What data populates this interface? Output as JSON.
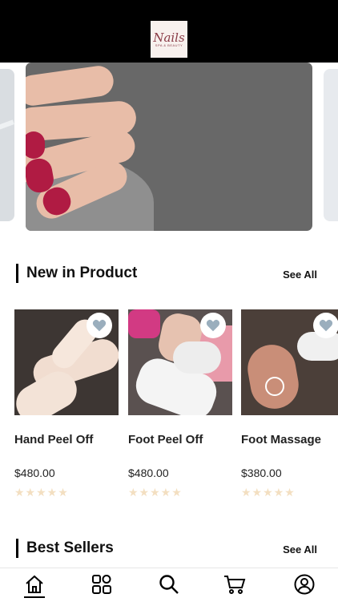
{
  "header": {
    "logo_text": "Nails",
    "logo_tagline": "SPA & BEAUTY"
  },
  "sections": {
    "new_in_product": {
      "title": "New in Product",
      "see_all": "See All"
    },
    "best_sellers": {
      "title": "Best Sellers",
      "see_all": "See All"
    }
  },
  "products": [
    {
      "name": "Hand Peel Off",
      "price": "$480.00",
      "rating": 0,
      "stars": "★★★★★"
    },
    {
      "name": "Foot Peel Off",
      "price": "$480.00",
      "rating": 0,
      "stars": "★★★★★"
    },
    {
      "name": "Foot Massage",
      "price": "$380.00",
      "rating": 0,
      "stars": "★★★★★"
    }
  ],
  "tabbar": {
    "items": [
      {
        "icon": "home-icon",
        "active": true
      },
      {
        "icon": "grid-icon",
        "active": false
      },
      {
        "icon": "search-icon",
        "active": false
      },
      {
        "icon": "cart-icon",
        "active": false
      },
      {
        "icon": "profile-icon",
        "active": false
      }
    ]
  },
  "colors": {
    "header_bg": "#000000",
    "heart_fill": "#9aaebd",
    "star_empty": "#f3dfc1",
    "nail_polish": "#b01b43"
  }
}
